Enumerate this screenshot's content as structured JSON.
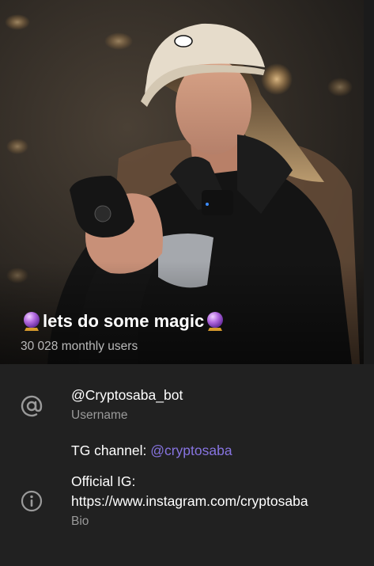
{
  "header": {
    "title": "lets do some magic",
    "title_prefix_icon": "crystal-ball-emoji",
    "title_suffix_icon": "crystal-ball-emoji",
    "monthly_users": "30 028 monthly users"
  },
  "username": {
    "icon": "at-sign-icon",
    "value": "@Cryptosaba_bot",
    "label": "Username"
  },
  "bio": {
    "icon": "info-icon",
    "channel_prefix": "TG channel: ",
    "channel_link": "@cryptosaba",
    "ig_label": "Official IG:",
    "ig_url": "https://www.instagram.com/cryptosaba",
    "label": "Bio"
  },
  "colors": {
    "background": "#212121",
    "link": "#8774e1",
    "secondary_text": "#9a9a9a"
  }
}
